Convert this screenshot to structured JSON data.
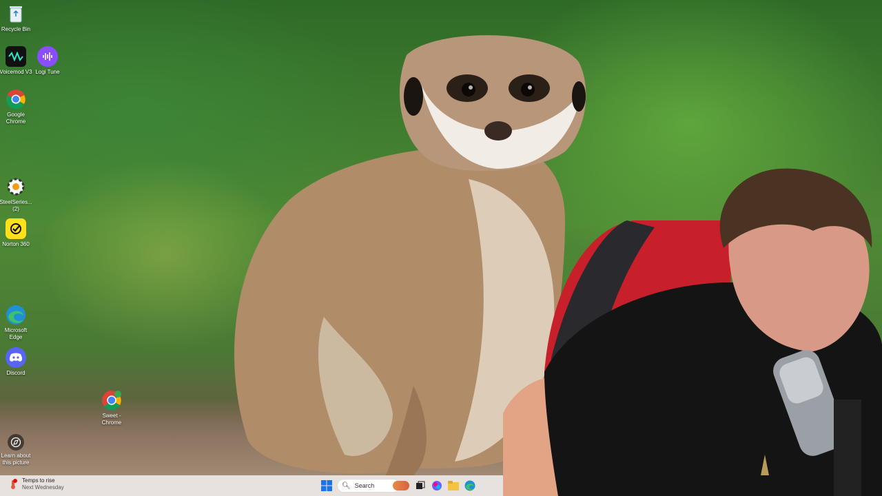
{
  "desktop": {
    "icons": [
      {
        "label": "Recycle Bin"
      },
      {
        "label": "Voicemod V3"
      },
      {
        "label": "Logi Tune"
      },
      {
        "label": "Google Chrome"
      },
      {
        "label": "SteelSeries... (2)"
      },
      {
        "label": "Norton 360"
      },
      {
        "label": "Microsoft Edge"
      },
      {
        "label": "Discord"
      },
      {
        "label": "Sweet - Chrome"
      },
      {
        "label": "Learn about this picture"
      }
    ]
  },
  "taskbar": {
    "weather_title": "Temps to rise",
    "weather_sub": "Next Wednesday",
    "search_placeholder": "Search"
  },
  "colors": {
    "taskbar_bg": "#f0ecea",
    "chrome_red": "#db4437",
    "discord": "#5865f2",
    "norton": "#ffe01b"
  }
}
